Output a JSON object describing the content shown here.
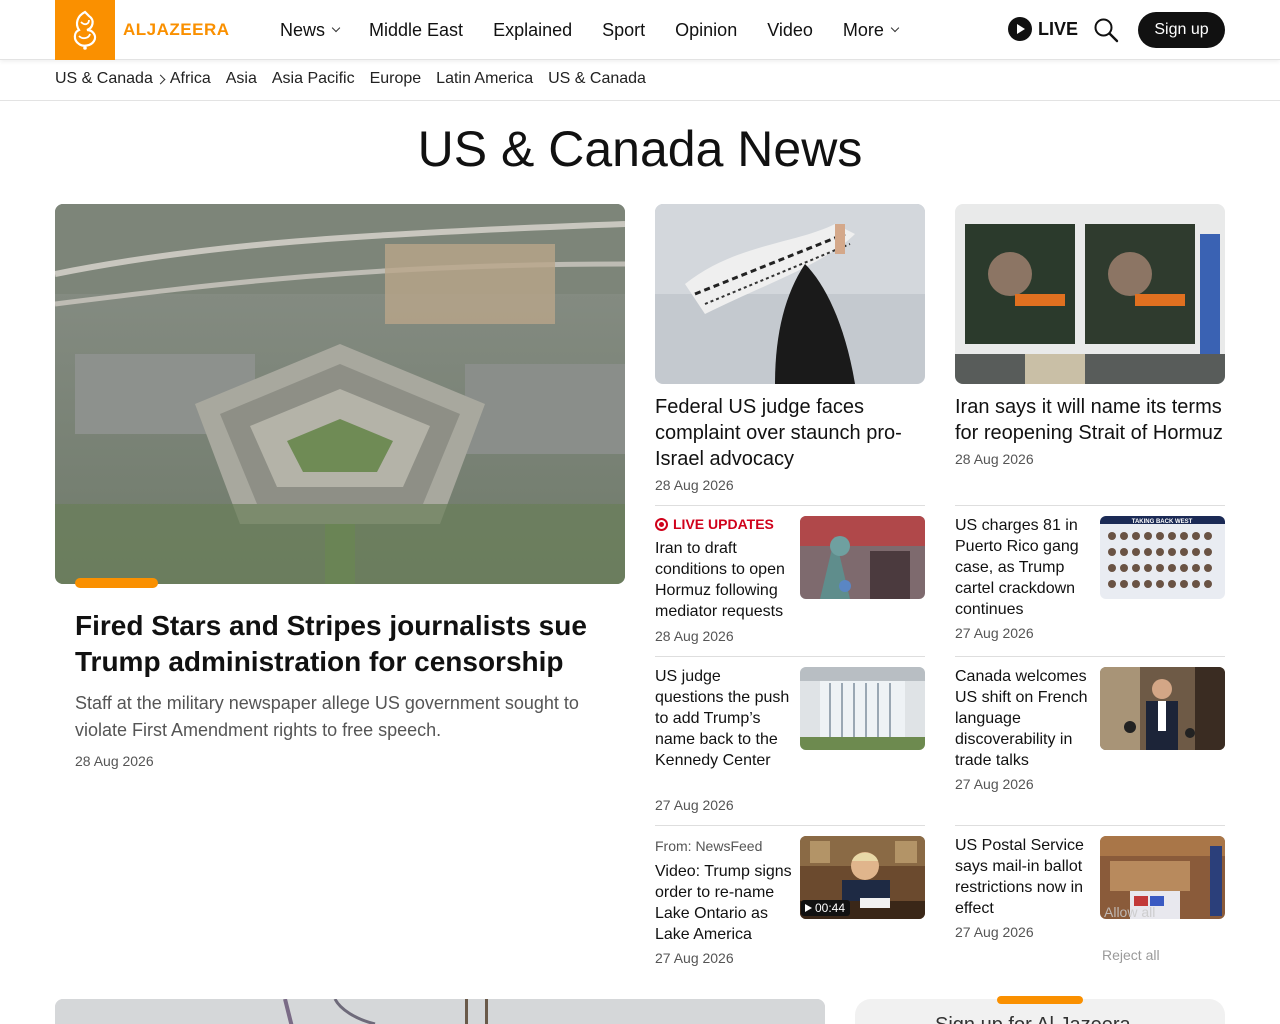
{
  "brand": {
    "name": "ALJAZEERA",
    "color": "#fa9000"
  },
  "nav": {
    "items": [
      {
        "label": "News",
        "dropdown": true
      },
      {
        "label": "Middle East",
        "dropdown": false
      },
      {
        "label": "Explained",
        "dropdown": false
      },
      {
        "label": "Sport",
        "dropdown": false
      },
      {
        "label": "Opinion",
        "dropdown": false
      },
      {
        "label": "Video",
        "dropdown": false
      },
      {
        "label": "More",
        "dropdown": true
      }
    ],
    "live_label": "LIVE",
    "signup_label": "Sign up"
  },
  "subnav": {
    "current": "US & Canada",
    "links": [
      "Africa",
      "Asia",
      "Asia Pacific",
      "Europe",
      "Latin America",
      "US & Canada"
    ]
  },
  "page": {
    "title": "US & Canada News"
  },
  "hero": {
    "title": "Fired Stars and Stripes journalists sue Trump administration for censorship",
    "description": "Staff at the military newspaper allege US government sought to violate First Amendment rights to free speech.",
    "date": "28 Aug 2026"
  },
  "cards": [
    {
      "title": "Federal US judge faces complaint over staunch pro-Israel advocacy",
      "date": "28 Aug 2026"
    },
    {
      "title": "Iran says it will name its terms for reopening Strait of Hormuz",
      "date": "28 Aug 2026"
    }
  ],
  "list_left": [
    {
      "badge": "LIVE UPDATES",
      "title": "Iran to draft conditions to open Hormuz following mediator requests",
      "date": "28 Aug 2026"
    },
    {
      "title": "US judge questions the push to add Trump’s name back to the Kennedy Center",
      "date": "27 Aug 2026"
    },
    {
      "source": "From: NewsFeed",
      "title": "Video: Trump signs order to re-name Lake Ontario as Lake America",
      "date": "27 Aug 2026",
      "duration": "00:44"
    }
  ],
  "list_right": [
    {
      "title": "US charges 81 in Puerto Rico gang case, as Trump cartel crackdown continues",
      "date": "27 Aug 2026",
      "thumb_caption": "TAKING BACK WEST"
    },
    {
      "title": "Canada welcomes US shift on French language discoverability in trade talks",
      "date": "27 Aug 2026"
    },
    {
      "title": "US Postal Service says mail-in ballot restrictions now in effect",
      "date": "27 Aug 2026"
    }
  ],
  "consent": {
    "allow_all": "Allow all",
    "reject_all": "Reject all"
  },
  "bottom": {
    "signup_peek": "Sign up for Al Jazeera"
  }
}
